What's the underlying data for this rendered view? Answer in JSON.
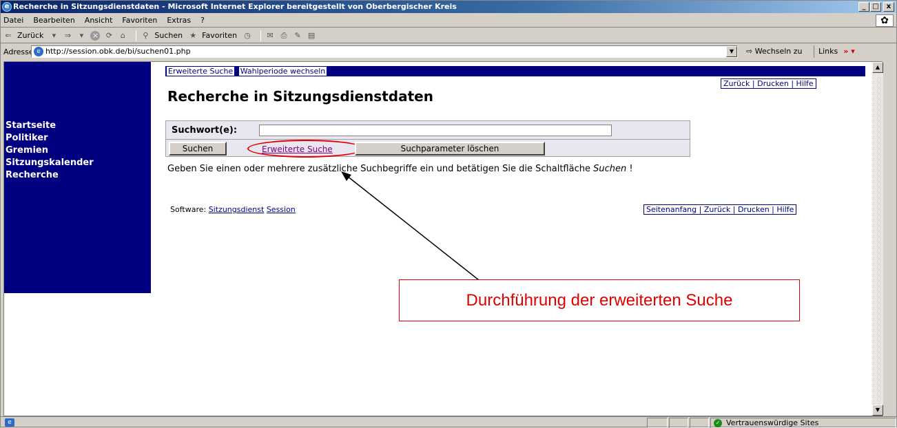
{
  "window": {
    "title": "Recherche in Sitzungsdienstdaten - Microsoft Internet Explorer bereitgestellt von Oberbergischer Kreis",
    "controls": {
      "minimize": "_",
      "maximize": "□",
      "close": "x"
    }
  },
  "menu": [
    "Datei",
    "Bearbeiten",
    "Ansicht",
    "Favoriten",
    "Extras",
    "?"
  ],
  "toolbar": {
    "back_label": "Zurück",
    "search_label": "Suchen",
    "favorites_label": "Favoriten"
  },
  "address": {
    "label": "Adresse",
    "url": "http://session.obk.de/bi/suchen01.php",
    "go_label": "Wechseln zu",
    "links_label": "Links"
  },
  "sidebar": {
    "items": [
      "Startseite",
      "Politiker",
      "Gremien",
      "Sitzungskalender",
      "Recherche"
    ]
  },
  "topnav": {
    "items": [
      "Erweiterte Suche",
      "Wahlperiode wechseln"
    ]
  },
  "top_right_links": "Zurück | Drucken | Hilfe",
  "page": {
    "title": "Recherche in Sitzungsdienstdaten",
    "search_label": "Suchwort(e):",
    "search_value": "",
    "search_button": "Suchen",
    "advanced_link": "Erweiterte Suche",
    "clear_button": "Suchparameter löschen",
    "hint_prefix": "Geben Sie einen oder mehrere zusätzliche Suchbegriffe ein und betätigen Sie die Schaltfläche ",
    "hint_em": "Suchen",
    "hint_suffix": "!",
    "software_label": "Software:",
    "software_link1": "Sitzungsdienst",
    "software_link2": "Session",
    "bottom_right_links": "Seitenanfang | Zurück | Drucken | Hilfe"
  },
  "annotation": {
    "callout_text": "Durchführung der erweiterten Suche",
    "color": "#e00000"
  },
  "status": {
    "zone": "Vertrauenswürdige Sites"
  },
  "colors": {
    "nav_bg": "#000080",
    "visited_link": "#800080"
  }
}
